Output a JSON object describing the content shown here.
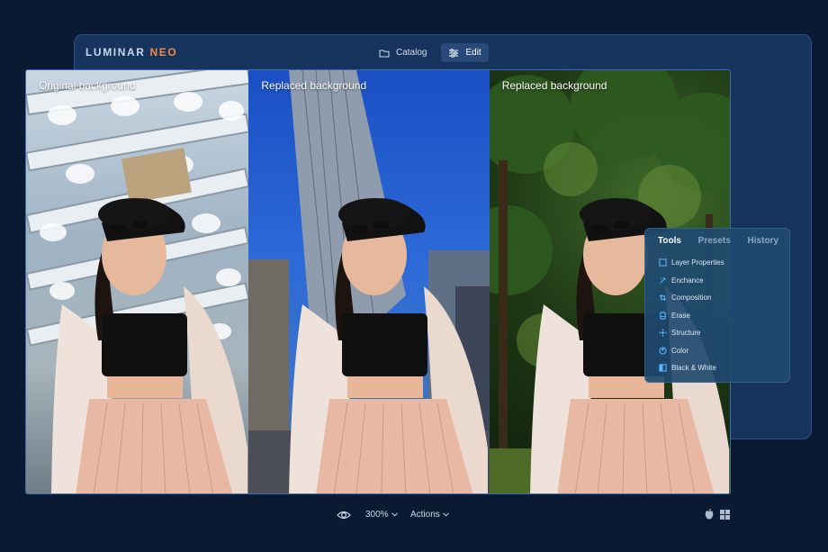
{
  "app": {
    "logo_primary": "LUMINAR",
    "logo_accent": "NEO",
    "tabs": [
      {
        "label": "Catalog",
        "icon": "folder-icon",
        "active": false
      },
      {
        "label": "Edit",
        "icon": "sliders-icon",
        "active": true
      }
    ]
  },
  "preview": {
    "panels": [
      {
        "label": "Original background"
      },
      {
        "label": "Replaced background"
      },
      {
        "label": "Replaced background"
      }
    ]
  },
  "tools_panel": {
    "tabs": [
      "Tools",
      "Presets",
      "History"
    ],
    "active_tab": "Tools",
    "items": [
      {
        "label": "Layer Properties",
        "icon": "layer-properties-icon"
      },
      {
        "label": "Enchance",
        "icon": "enhance-icon"
      },
      {
        "label": "Composition",
        "icon": "composition-icon"
      },
      {
        "label": "Erase",
        "icon": "erase-icon"
      },
      {
        "label": "Structure",
        "icon": "structure-icon"
      },
      {
        "label": "Color",
        "icon": "color-icon"
      },
      {
        "label": "Black & White",
        "icon": "black-white-icon"
      }
    ]
  },
  "bottom_bar": {
    "zoom": "300%",
    "actions": "Actions",
    "platforms": [
      "apple-icon",
      "windows-icon"
    ]
  },
  "colors": {
    "background": "#0b1a33",
    "window": "#17345e",
    "accent": "#f08a4b",
    "tool_icon": "#5ab4ff"
  }
}
